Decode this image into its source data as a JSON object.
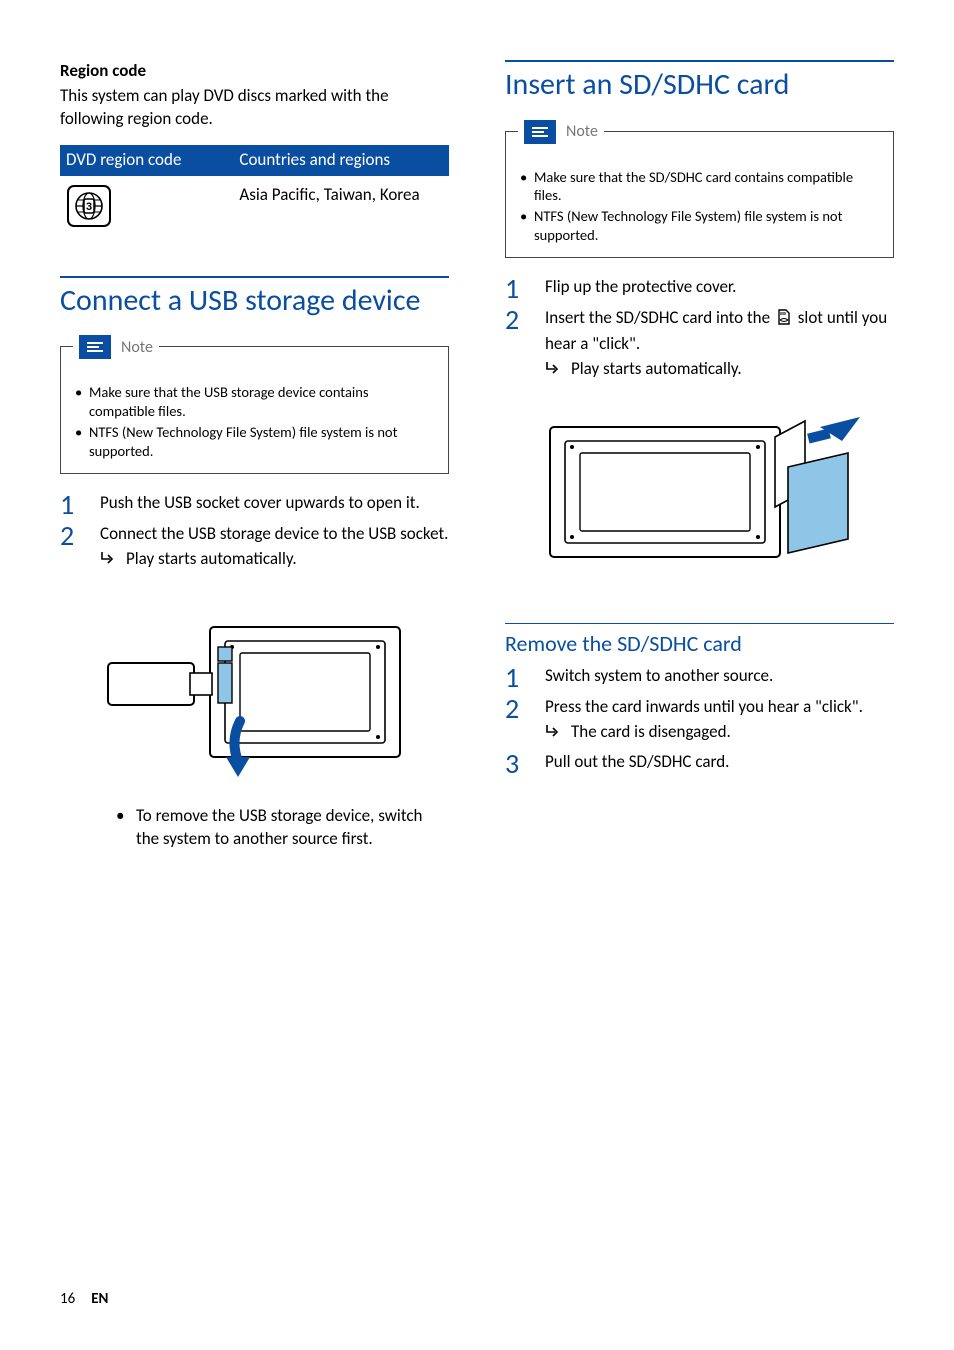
{
  "left": {
    "region_code_heading": "Region code",
    "region_code_body": "This system can play DVD discs marked with the following region code.",
    "table": {
      "head_a": "DVD region code",
      "head_b": "Countries and regions",
      "row_region_label": "3",
      "row_countries": "Asia Pacific, Taiwan, Korea"
    },
    "usb_heading": "Connect a USB storage device",
    "note_label": "Note",
    "usb_notes": [
      "Make sure that the USB storage device contains compatible files.",
      "NTFS (New Technology File System) file system is not supported."
    ],
    "usb_steps": [
      {
        "text": "Push the USB socket cover upwards to open it."
      },
      {
        "text": "Connect the USB storage device to the USB socket.",
        "result": "Play starts automatically."
      }
    ],
    "usb_remove_bullet": "To remove the USB storage device, switch the system to another source first."
  },
  "right": {
    "sd_heading": "Insert an SD/SDHC card",
    "note_label": "Note",
    "sd_notes": [
      "Make sure that the SD/SDHC card contains compatible files.",
      "NTFS (New Technology File System) file system is not supported."
    ],
    "sd_step1": "Flip up the protective cover.",
    "sd_step2_prefix": "Insert the SD/SDHC card into the ",
    "sd_step2_suffix": " slot until you hear a \"click\".",
    "sd_step2_result": "Play starts automatically.",
    "remove_heading": "Remove the SD/SDHC card",
    "remove_steps": [
      {
        "text": "Switch system to another source."
      },
      {
        "text": "Press the card inwards until you hear a \"click\".",
        "result": "The card is disengaged."
      },
      {
        "text": "Pull out the SD/SDHC card."
      }
    ]
  },
  "footer": {
    "page": "16",
    "lang": "EN"
  }
}
